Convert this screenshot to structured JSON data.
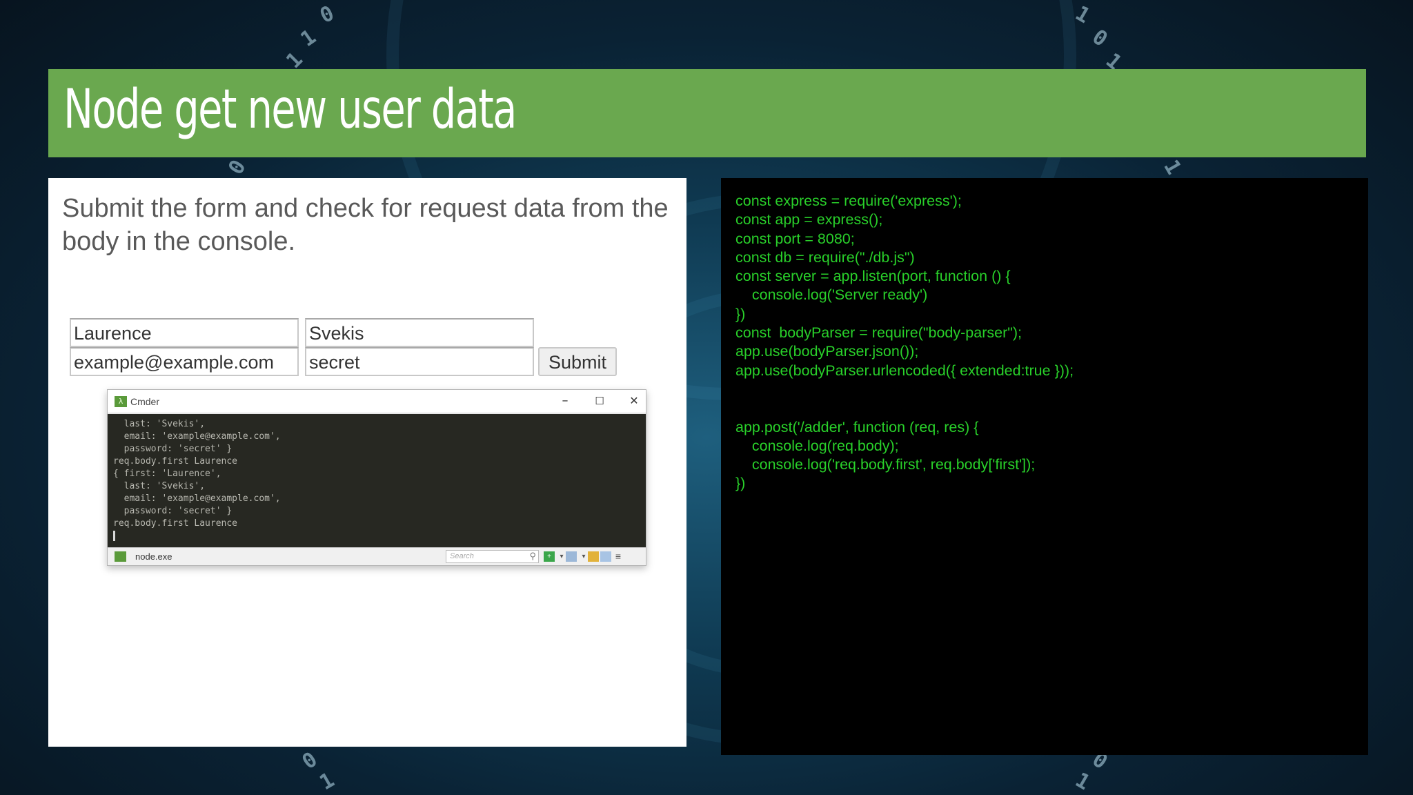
{
  "slide": {
    "title": "Node get new user data",
    "instruction": "Submit the form and check for request data from the body in the console."
  },
  "form": {
    "first_value": "Laurence",
    "last_value": "Svekis",
    "email_value": "example@example.com",
    "password_value": "secret",
    "submit_label": "Submit"
  },
  "console_window": {
    "title": "Cmder",
    "minimize_glyph": "–",
    "maximize_glyph": "☐",
    "close_glyph": "✕",
    "output_lines": [
      "  last: 'Svekis',",
      "  email: 'example@example.com',",
      "  password: 'secret' }",
      "req.body.first Laurence",
      "{ first: 'Laurence',",
      "  last: 'Svekis',",
      "  email: 'example@example.com',",
      "  password: 'secret' }",
      "req.body.first Laurence"
    ],
    "status_tab": "node.exe",
    "search_placeholder": "Search"
  },
  "code_lines": [
    "const express = require('express');",
    "const app = express();",
    "const port = 8080;",
    "const db = require(\"./db.js\")",
    "const server = app.listen(port, function () {",
    "    console.log('Server ready')",
    "})",
    "const  bodyParser = require(\"body-parser\");",
    "app.use(bodyParser.json());",
    "app.use(bodyParser.urlencoded({ extended:true }));",
    "",
    "",
    "app.post('/adder', function (req, res) {",
    "    console.log(req.body);",
    "    console.log('req.body.first', req.body['first']);",
    "})"
  ],
  "colors": {
    "title_bar": "#6aa84f",
    "code_text": "#29d02a",
    "code_background": "#000000",
    "console_background": "#272822"
  }
}
